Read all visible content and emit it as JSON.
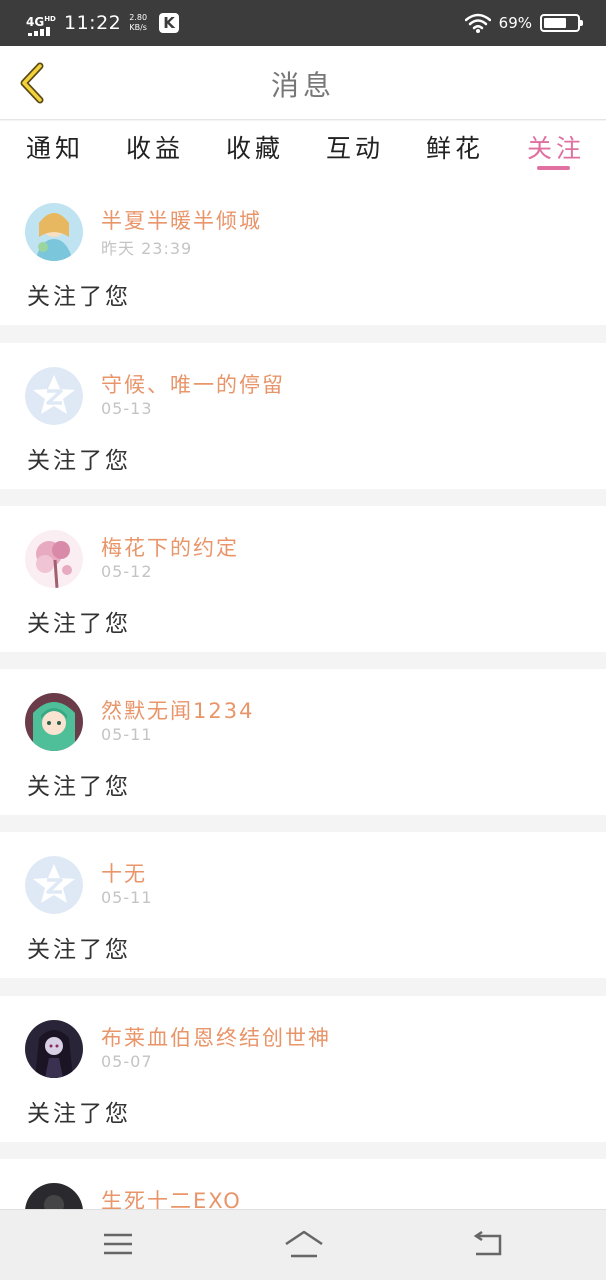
{
  "status_bar": {
    "network": "4G",
    "network_sup": "HD",
    "time": "11:22",
    "speed_value": "2.80",
    "speed_unit": "KB/s",
    "app_badge": "K",
    "battery_text": "69%",
    "battery_level": 0.69
  },
  "header": {
    "back_icon": "chevron-left-icon",
    "title": "消息"
  },
  "tabs": [
    {
      "label": "通知"
    },
    {
      "label": "收益"
    },
    {
      "label": "收藏"
    },
    {
      "label": "互动"
    },
    {
      "label": "鲜花"
    },
    {
      "label": "关注",
      "active": true
    }
  ],
  "messages": [
    {
      "name": "半夏半暖半倾城",
      "date": "昨天 23:39",
      "text": "关注了您",
      "avatar": "anime-girl-blue"
    },
    {
      "name": "守候、唯一的停留",
      "date": "05-13",
      "text": "关注了您",
      "avatar": "default-qzone"
    },
    {
      "name": "梅花下的约定",
      "date": "05-12",
      "text": "关注了您",
      "avatar": "pink-blossom"
    },
    {
      "name": "然默无闻1234",
      "date": "05-11",
      "text": "关注了您",
      "avatar": "anime-girl-green"
    },
    {
      "name": "十无",
      "date": "05-11",
      "text": "关注了您",
      "avatar": "default-qzone"
    },
    {
      "name": "布莱血伯恩终结创世神",
      "date": "05-07",
      "text": "关注了您",
      "avatar": "dark-anime"
    },
    {
      "name": "生死十二EXO",
      "date": "",
      "text": "",
      "avatar": "dark-figure"
    }
  ],
  "nav_bar": {
    "menu_icon": "menu-icon",
    "home_icon": "home-icon",
    "back_icon": "back-icon"
  },
  "colors": {
    "accent": "#e070a0",
    "username": "#e8956a",
    "date": "#c4c4c4",
    "status_bar": "#3c3c3c"
  }
}
